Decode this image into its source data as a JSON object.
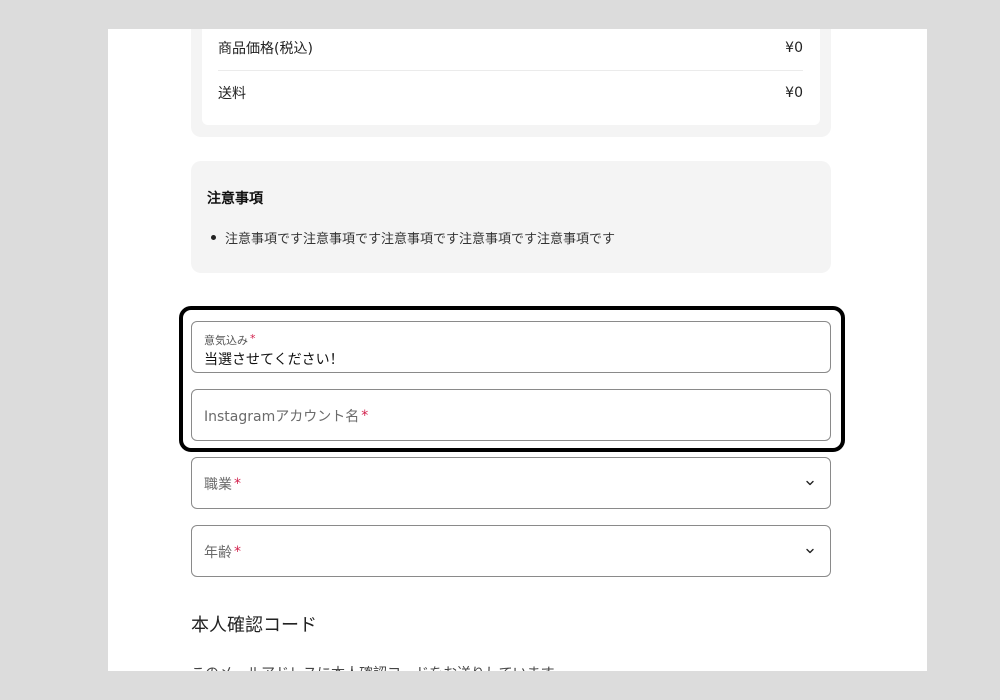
{
  "price_summary": {
    "rows": [
      {
        "label": "商品価格(税込)",
        "value": "¥0"
      },
      {
        "label": "送料",
        "value": "¥0"
      }
    ]
  },
  "notice": {
    "title": "注意事項",
    "items": [
      "注意事項です注意事項です注意事項です注意事項です注意事項です"
    ]
  },
  "form": {
    "motivation": {
      "label": "意気込み",
      "required_mark": "*",
      "value": "当選させてください！"
    },
    "instagram": {
      "placeholder": "Instagramアカウント名",
      "required_mark": "*"
    },
    "occupation": {
      "placeholder": "職業",
      "required_mark": "*"
    },
    "age": {
      "placeholder": "年齢",
      "required_mark": "*"
    }
  },
  "verification": {
    "title": "本人確認コード",
    "description": "このメールアドレスに本人確認コードをお送りしています"
  },
  "icons": {
    "select_chevron": "chevron-down-icon"
  },
  "colors": {
    "required": "#d21f4b",
    "highlight_border": "#000000",
    "panel_bg": "#f4f4f4"
  }
}
